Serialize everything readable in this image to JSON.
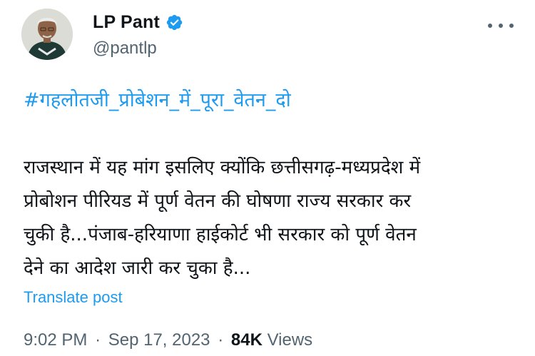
{
  "author": {
    "display_name": "LP Pant",
    "handle": "@pantlp",
    "verified": true,
    "verified_color": "#1d9bf0"
  },
  "tweet": {
    "hashtag": "#गहलोतजी_प्रोबेशन_में_पूरा_वेतन_दो",
    "lines": [
      "राजस्थान में यह मांग इसलिए क्योंकि छत्तीसगढ़-मध्यप्रदेश में",
      "प्रोबोशन पीरियड में पूर्ण वेतन की घोषणा राज्य सरकार कर",
      "चुकी है...पंजाब-हरियाणा हाईकोर्ट भी सरकार को पूर्ण वेतन",
      "देने का आदेश जारी कर चुका है..."
    ],
    "translate_label": "Translate post"
  },
  "meta": {
    "time": "9:02 PM",
    "separator": "·",
    "date": "Sep 17, 2023",
    "views_count": "84K",
    "views_label": "Views"
  },
  "icons": {
    "verified": "verified-badge-icon",
    "more": "more-options-icon"
  },
  "colors": {
    "link": "#1d9bf0",
    "secondary_text": "#536471",
    "primary_text": "#0f1419"
  }
}
